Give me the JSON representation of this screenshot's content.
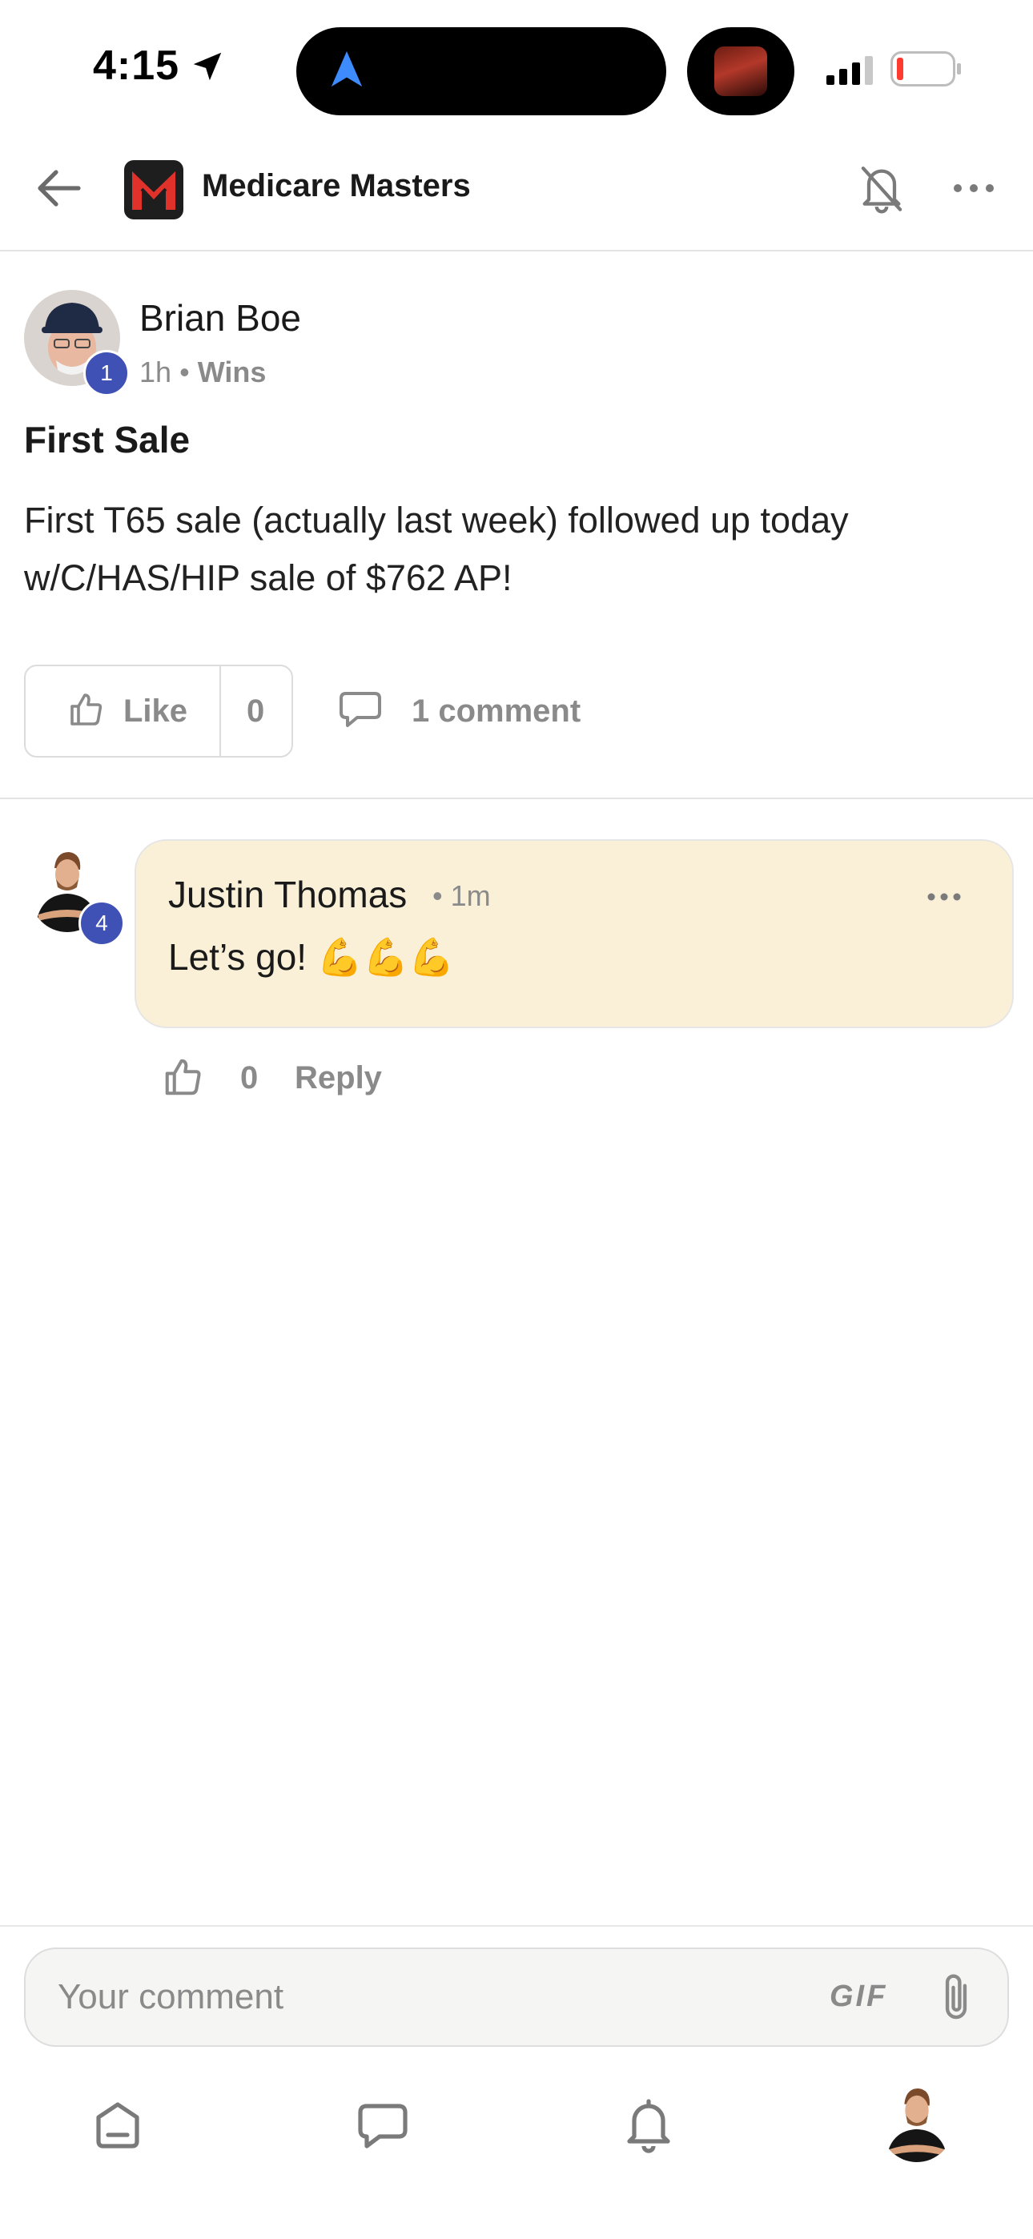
{
  "status_bar": {
    "time": "4:15"
  },
  "header": {
    "title": "Medicare Masters"
  },
  "post": {
    "author": "Brian Boe",
    "author_level": "1",
    "time": "1h",
    "separator": "•",
    "category": "Wins",
    "title": "First Sale",
    "body": "First T65 sale (actually last week) followed up today w/C/HAS/HIP sale of $762 AP!",
    "like_label": "Like",
    "like_count": "0",
    "comment_label": "1 comment"
  },
  "comment": {
    "author": "Justin Thomas",
    "author_level": "4",
    "time": "• 1m",
    "text": "Let’s go! 💪💪💪",
    "like_count": "0",
    "reply_label": "Reply"
  },
  "composer": {
    "placeholder": "Your comment",
    "gif_label": "GIF"
  },
  "colors": {
    "level_badge": "#3f51b5",
    "comment_bubble": "#faf0d8",
    "muted_text": "#8a8a8a"
  }
}
